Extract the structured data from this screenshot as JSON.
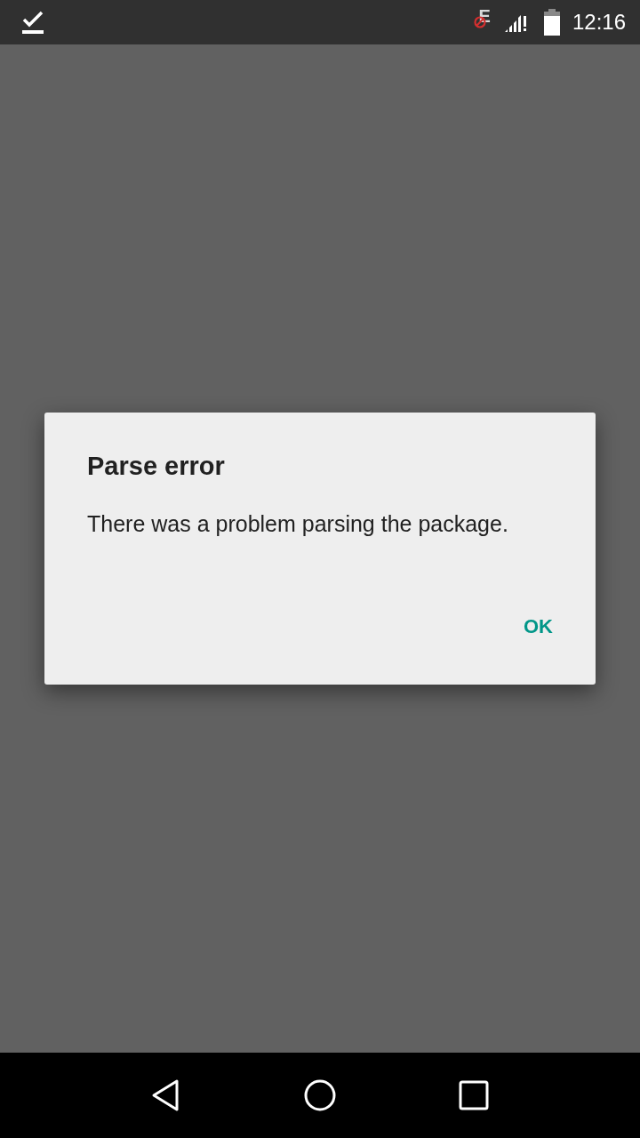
{
  "status_bar": {
    "network_type": "E",
    "time": "12:16"
  },
  "dialog": {
    "title": "Parse error",
    "message": "There was a problem parsing the package.",
    "buttons": [
      "OK"
    ]
  }
}
